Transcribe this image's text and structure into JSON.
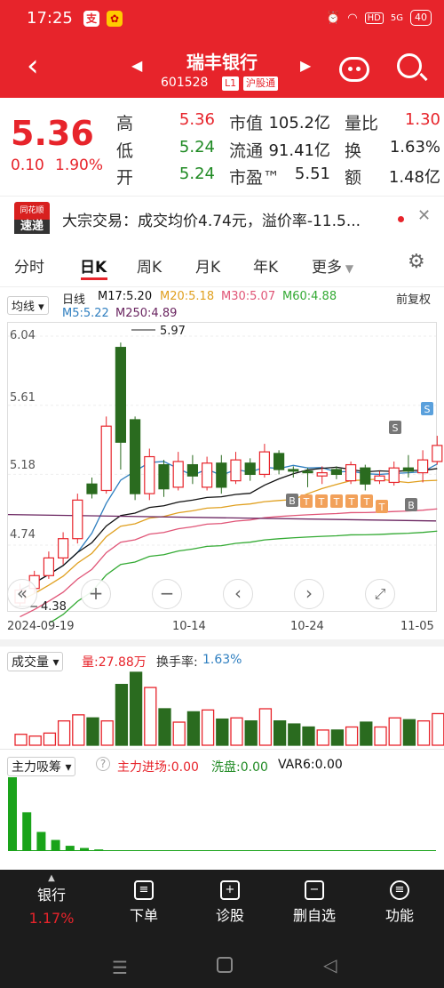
{
  "status": {
    "time": "17:25",
    "battery": "40",
    "signal": "5G",
    "hd": "HD"
  },
  "header": {
    "stock_name": "瑞丰银行",
    "stock_code": "601528",
    "tag_l1": "L1",
    "tag_market": "沪股通"
  },
  "quote": {
    "price": "5.36",
    "change": "0.10",
    "change_pct": "1.90%",
    "high_label": "高",
    "high": "5.36",
    "low_label": "低",
    "low": "5.24",
    "open_label": "开",
    "open": "5.24",
    "mcap_label": "市值",
    "mcap": "105.2亿",
    "float_label": "流通",
    "float": "91.41亿",
    "pe_label": "市盈™",
    "pe": "5.51",
    "vr_label": "量比",
    "vr": "1.30",
    "turnover_label": "换",
    "turnover": "1.63%",
    "amount_label": "额",
    "amount": "1.48亿"
  },
  "news": {
    "logo_top": "同花顺",
    "logo_bottom": "速递",
    "text": "大宗交易：成交均价4.74元，溢价率-11.5..."
  },
  "tabs": [
    {
      "label": "分时"
    },
    {
      "label": "日K"
    },
    {
      "label": "周K"
    },
    {
      "label": "月K"
    },
    {
      "label": "年K"
    },
    {
      "label": "更多"
    }
  ],
  "chart_header": {
    "ma_dropdown": "均线",
    "period": "日线",
    "ma17": "M17:5.20",
    "ma20": "M20:5.18",
    "ma30": "M30:5.07",
    "ma60": "M60:4.88",
    "ma5": "M5:5.22",
    "ma250": "M250:4.89",
    "adjust": "前复权"
  },
  "colors": {
    "up": "#e7242b",
    "down": "#2a6b1f",
    "ma5": "#2f7fc0",
    "ma17": "#111111",
    "ma20": "#e0a020",
    "ma30": "#e05577",
    "ma60": "#33aa33",
    "ma250": "#6a2560"
  },
  "chart_data": {
    "type": "candlestick",
    "y_ticks": [
      "6.04",
      "5.61",
      "5.18",
      "4.74"
    ],
    "x_ticks": [
      "2024-09-19",
      "10-14",
      "10-24",
      "11-05"
    ],
    "high_marker": "5.97",
    "low_marker": "4.38",
    "signals": [
      "B",
      "S",
      "B",
      "S"
    ],
    "t_markers": [
      "T",
      "T",
      "T",
      "T",
      "T",
      "T"
    ],
    "candles": [
      {
        "o": 4.38,
        "c": 4.46,
        "h": 4.5,
        "l": 4.36
      },
      {
        "o": 4.47,
        "c": 4.55,
        "h": 4.58,
        "l": 4.44
      },
      {
        "o": 4.55,
        "c": 4.66,
        "h": 4.7,
        "l": 4.53
      },
      {
        "o": 4.66,
        "c": 4.78,
        "h": 4.82,
        "l": 4.62
      },
      {
        "o": 4.78,
        "c": 5.02,
        "h": 5.06,
        "l": 4.75
      },
      {
        "o": 5.12,
        "c": 5.06,
        "h": 5.16,
        "l": 5.03
      },
      {
        "o": 5.08,
        "c": 5.48,
        "h": 5.54,
        "l": 5.06
      },
      {
        "o": 5.97,
        "c": 5.38,
        "h": 6.0,
        "l": 5.21
      },
      {
        "o": 5.52,
        "c": 5.06,
        "h": 5.54,
        "l": 5.02
      },
      {
        "o": 5.06,
        "c": 5.29,
        "h": 5.34,
        "l": 5.02
      },
      {
        "o": 5.24,
        "c": 5.09,
        "h": 5.27,
        "l": 5.04
      },
      {
        "o": 5.1,
        "c": 5.26,
        "h": 5.32,
        "l": 5.08
      },
      {
        "o": 5.24,
        "c": 5.17,
        "h": 5.3,
        "l": 5.12
      },
      {
        "o": 5.1,
        "c": 5.25,
        "h": 5.29,
        "l": 5.08
      },
      {
        "o": 5.25,
        "c": 5.1,
        "h": 5.3,
        "l": 5.06
      },
      {
        "o": 5.14,
        "c": 5.27,
        "h": 5.32,
        "l": 5.12
      },
      {
        "o": 5.25,
        "c": 5.18,
        "h": 5.28,
        "l": 5.14
      },
      {
        "o": 5.18,
        "c": 5.32,
        "h": 5.37,
        "l": 5.16
      },
      {
        "o": 5.31,
        "c": 5.21,
        "h": 5.33,
        "l": 5.18
      },
      {
        "o": 5.21,
        "c": 5.2,
        "h": 5.23,
        "l": 5.16
      },
      {
        "o": 5.2,
        "c": 5.19,
        "h": 5.22,
        "l": 5.1
      },
      {
        "o": 5.17,
        "c": 5.19,
        "h": 5.23,
        "l": 5.12
      },
      {
        "o": 5.21,
        "c": 5.18,
        "h": 5.23,
        "l": 5.15
      },
      {
        "o": 5.14,
        "c": 5.24,
        "h": 5.26,
        "l": 5.12
      },
      {
        "o": 5.22,
        "c": 5.12,
        "h": 5.24,
        "l": 5.08
      },
      {
        "o": 5.14,
        "c": 5.17,
        "h": 5.2,
        "l": 5.12
      },
      {
        "o": 5.13,
        "c": 5.22,
        "h": 5.26,
        "l": 5.11
      },
      {
        "o": 5.22,
        "c": 5.2,
        "h": 5.3,
        "l": 5.16
      },
      {
        "o": 5.19,
        "c": 5.27,
        "h": 5.33,
        "l": 5.13
      },
      {
        "o": 5.26,
        "c": 5.36,
        "h": 5.42,
        "l": 5.24
      }
    ]
  },
  "volume_panel": {
    "title": "成交量",
    "volume": "量:27.88万",
    "turnover_label": "换手率:",
    "turnover": "1.63%",
    "bars": [
      0.18,
      0.15,
      0.2,
      0.4,
      0.5,
      0.45,
      0.4,
      1.0,
      1.2,
      0.95,
      0.6,
      0.38,
      0.55,
      0.58,
      0.43,
      0.45,
      0.4,
      0.6,
      0.4,
      0.35,
      0.3,
      0.25,
      0.25,
      0.3,
      0.38,
      0.3,
      0.45,
      0.42,
      0.4,
      0.52
    ]
  },
  "flow_panel": {
    "title": "主力吸筹",
    "help": "?",
    "inflow": "主力进场:0.00",
    "washout": "洗盘:0.00",
    "var6": "VAR6:0.00",
    "bars": [
      1.0,
      0.52,
      0.25,
      0.14,
      0.06,
      0.03,
      0.01,
      0,
      0,
      0,
      0,
      0,
      0,
      0,
      0,
      0,
      0,
      0,
      0,
      0,
      0,
      0,
      0,
      0,
      0,
      0,
      0,
      0,
      0,
      0
    ]
  },
  "bottom_nav": {
    "sector_name": "银行",
    "sector_pct": "1.17%",
    "items": [
      {
        "label": "下单"
      },
      {
        "label": "诊股"
      },
      {
        "label": "删自选"
      },
      {
        "label": "功能"
      }
    ]
  }
}
